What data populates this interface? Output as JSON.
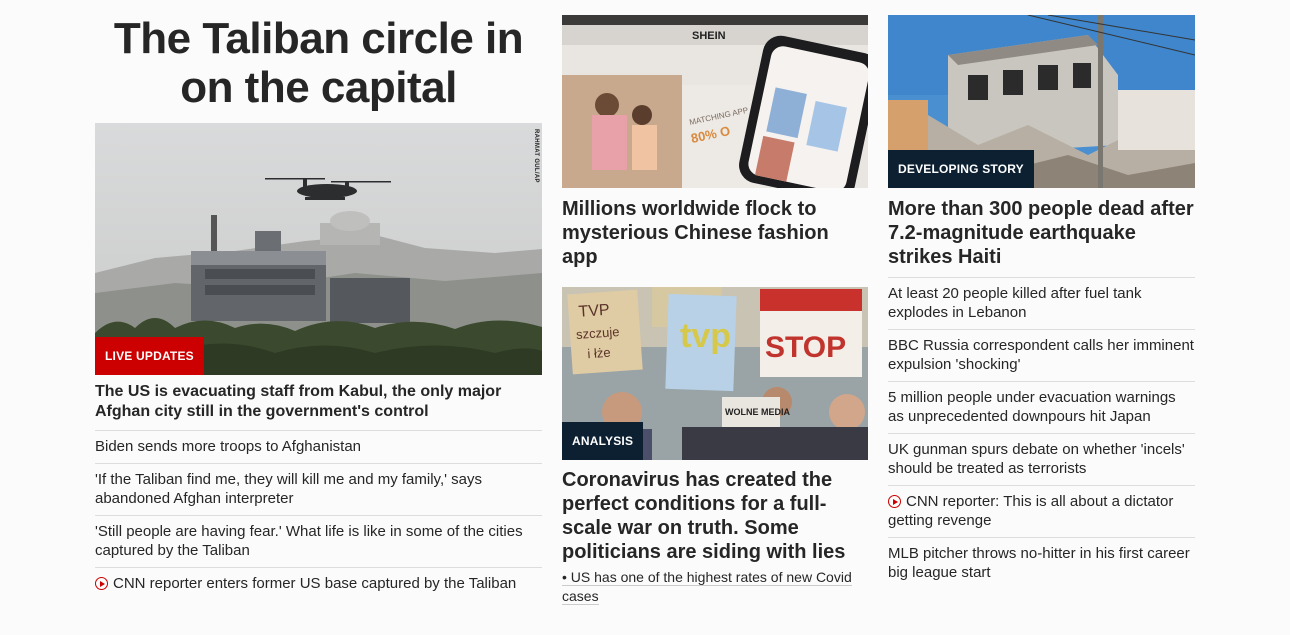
{
  "col1": {
    "headline": "The Taliban circle in on the capital",
    "image_credit": "RAHMAT GUL/AP",
    "label": "LIVE UPDATES",
    "title": "The US is evacuating staff from Kabul, the only major Afghan city still in the government's control",
    "items": [
      "Biden sends more troops to Afghanistan",
      "'If the Taliban find me, they will kill me and my family,' says abandoned Afghan interpreter",
      "'Still people are having fear.' What life is like in some of the cities captured by the Taliban",
      "CNN reporter enters former US base captured by the Taliban"
    ]
  },
  "col2": {
    "story1": {
      "title": "Millions worldwide flock to mysterious Chinese fashion app",
      "image_text": "SHEIN"
    },
    "story2": {
      "label": "ANALYSIS",
      "title": "Coronavirus has created the perfect conditions for a full-scale war on truth. Some politicians are siding with lies",
      "sub": "• US has one of the highest rates of new Covid cases",
      "sign1": "TVP szczuje i łże",
      "sign2": "tvp",
      "sign3": "STOP",
      "sign4": "WOLNE MEDIA"
    }
  },
  "col3": {
    "label": "DEVELOPING STORY",
    "title": "More than 300 people dead after 7.2-magnitude earthquake strikes Haiti",
    "items": [
      "At least 20 people killed after fuel tank explodes in Lebanon",
      "BBC Russia correspondent calls her imminent expulsion 'shocking'",
      "5 million people under evacuation warnings as unprecedented downpours hit Japan",
      "UK gunman spurs debate on whether 'incels' should be treated as terrorists",
      "CNN reporter: This is all about a dictator getting revenge",
      "MLB pitcher throws no-hitter in his first career big league start"
    ]
  }
}
